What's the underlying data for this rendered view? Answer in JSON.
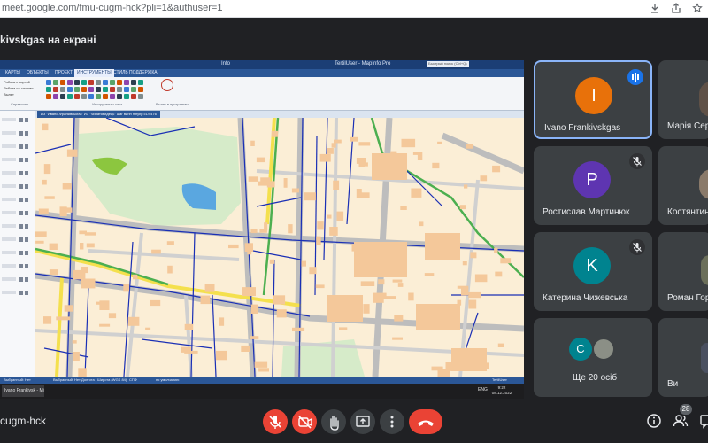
{
  "browser": {
    "url": "meet.google.com/fmu-cugm-hck?pli=1&authuser=1"
  },
  "banner": {
    "title": "kivskgas на екрані"
  },
  "shared_screen": {
    "window_title": "TertilUser - MapInfo Pro",
    "center_label": "Info",
    "search_placeholder": "Быстрый поиск (Ctrl+Q)",
    "ribbon_tabs": [
      "КАРТЫ",
      "ОБЪЕКТЫ",
      "ПРОЕКТ",
      "ИНСТРУМЕНТЫ",
      "СТИЛЬ",
      "ПОДДЕРЖКА"
    ],
    "active_ribbon_tab": "ИНСТРУМЕНТЫ",
    "layer_items": [
      "Работа с картой",
      "Работа со слоями",
      "Вылет"
    ],
    "group_labels": [
      "Справочно",
      "Инструменты карт",
      "Вылет в программы",
      "Справочно"
    ],
    "map_tab": "ИЗ \"Ивано-Франківськгаз\" ИЗ \"Чинатовидець\" шаг вигін нінуєр с1/4476",
    "status_items": [
      "Выбранный: Нет",
      "Выбранный: Нет",
      "Долгота / Широта (WGS 84)",
      "СПФ",
      "по умолчанию",
      "TertilUser"
    ],
    "taskbar_app": "Ivano Frankivsk - Mi...",
    "taskbar_lang": "ENG",
    "clock_time": "9:22",
    "clock_date": "08.12.2022"
  },
  "participants": [
    {
      "name": "Ivano Frankivskgas",
      "initial": "I",
      "color": "#e8710a",
      "state": "talking",
      "active": true
    },
    {
      "name": "Марія Сері",
      "initial": "",
      "color": "#3c4043",
      "state": "none",
      "active": false
    },
    {
      "name": "Ростислав Мартинюк",
      "initial": "P",
      "color": "#5e35b1",
      "state": "muted",
      "active": false
    },
    {
      "name": "Костянтин",
      "initial": "",
      "color": "#3c4043",
      "state": "none",
      "active": false
    },
    {
      "name": "Катерина Чижевська",
      "initial": "K",
      "color": "#00838f",
      "state": "muted",
      "active": false
    },
    {
      "name": "Роман Гор",
      "initial": "",
      "color": "#3c4043",
      "state": "none",
      "active": false
    },
    {
      "name": "Ще 20 осіб",
      "initial": "C",
      "color": "#00838f",
      "state": "none",
      "active": false
    },
    {
      "name": "Ви",
      "initial": "",
      "color": "#3c4043",
      "state": "none",
      "active": false
    }
  ],
  "bottom": {
    "meeting_code": "cugm-hck",
    "people_count": "28"
  },
  "colors": {
    "accent": "#8ab4f8",
    "end_call": "#ea4335",
    "tile_bg": "#3c4043"
  },
  "icons": [
    "mic-off-icon",
    "camera-off-icon",
    "raise-hand-icon",
    "present-icon",
    "more-icon",
    "end-call-icon",
    "info-icon",
    "people-icon",
    "chat-icon",
    "download-icon",
    "share-icon",
    "star-icon"
  ]
}
